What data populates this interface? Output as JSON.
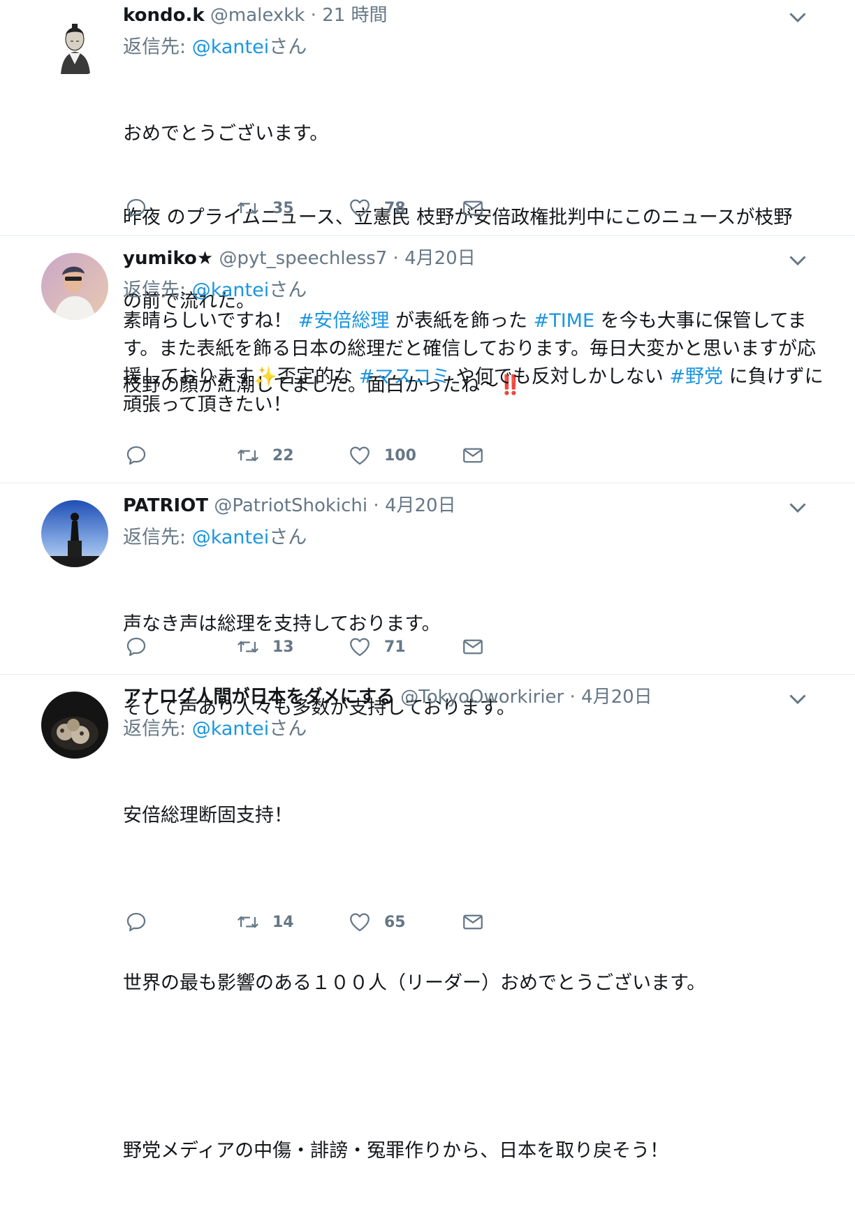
{
  "tweets": [
    {
      "name": "kondo.k",
      "handle": "@malexkk",
      "sep": " · ",
      "time": "21 時間",
      "reply_prefix": "返信先: ",
      "reply_mention": "@kantei",
      "reply_suffix": "さん",
      "body_lines": [
        "おめでとうございます。",
        "昨夜 のプライムニュース、立憲民 枝野が安倍政権批判中にこのニュースが枝野",
        "の前で流れた。",
        "枝野の顔が紅潮してました。面白かったね〜‼️"
      ],
      "retweets": "35",
      "likes": "78"
    },
    {
      "name": "yumiko★",
      "handle": "@pyt_speechless7",
      "sep": " · ",
      "time": "4月20日",
      "reply_prefix": "返信先: ",
      "reply_mention": "@kantei",
      "reply_suffix": "さん",
      "body_parts": [
        {
          "text": "素晴らしいですね！ "
        },
        {
          "text": "#安倍総理",
          "tag": true
        },
        {
          "text": " が表紙を飾った "
        },
        {
          "text": "#TIME",
          "tag": true
        },
        {
          "text": " を今も大事に保管してます。また表紙を飾る日本の総理だと確信しております。毎日大変かと思いますが応援しております✨否定的な "
        },
        {
          "text": "#マスコミ",
          "tag": true
        },
        {
          "text": " や何でも反対しかしない "
        },
        {
          "text": "#野党",
          "tag": true
        },
        {
          "text": " に負けずに頑張って頂きたい！"
        }
      ],
      "retweets": "22",
      "likes": "100"
    },
    {
      "name": "PATRIOT",
      "handle": "@PatriotShokichi",
      "sep": " · ",
      "time": "4月20日",
      "reply_prefix": "返信先: ",
      "reply_mention": "@kantei",
      "reply_suffix": "さん",
      "body_lines": [
        "声なき声は総理を支持しております。",
        "そして声あり人々も多数が支持しております。"
      ],
      "retweets": "13",
      "likes": "71"
    },
    {
      "name": "アナログ人間が日本をダメにする",
      "handle": "@TokyoOworkirier",
      "sep": " · ",
      "time": "4月20日",
      "reply_prefix": "返信先: ",
      "reply_mention": "@kantei",
      "reply_suffix": "さん",
      "body_lines": [
        "安倍総理断固支持！",
        "",
        "世界の最も影響のある１００人（リーダー）おめでとうございます。",
        "",
        "野党メディアの中傷・誹謗・冤罪作りから、日本を取り戻そう！"
      ],
      "retweets": "14",
      "likes": "65"
    }
  ],
  "icons": {
    "reply": "reply-icon",
    "retweet": "retweet-icon",
    "like": "heart-icon",
    "dm": "envelope-icon",
    "caret": "chevron-down-icon"
  },
  "colors": {
    "link": "#1b95e0",
    "secondary": "#657786",
    "text": "#14171a",
    "divider": "#e6ecf0"
  }
}
